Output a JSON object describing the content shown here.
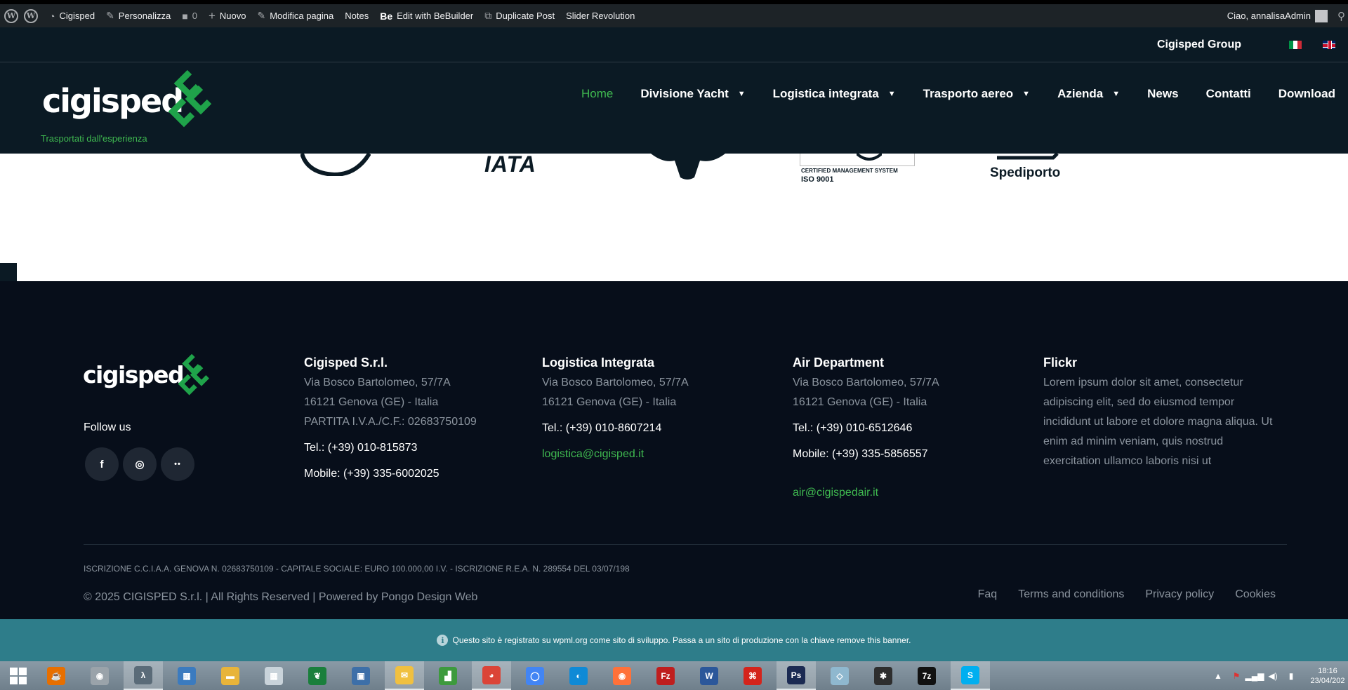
{
  "admin_bar": {
    "items": [
      {
        "label": "Cigisped",
        "icon": "dashboard-icon"
      },
      {
        "label": "Personalizza",
        "icon": "brush-icon"
      },
      {
        "label": "0",
        "icon": "comment-icon"
      },
      {
        "label": "Nuovo",
        "icon": "plus-icon"
      },
      {
        "label": "Modifica pagina",
        "icon": "pencil-icon"
      },
      {
        "label": "Notes",
        "icon": ""
      },
      {
        "label": "Edit with BeBuilder",
        "icon": "bebuilder-icon"
      },
      {
        "label": "Duplicate Post",
        "icon": "duplicate-icon"
      },
      {
        "label": "Slider Revolution",
        "icon": ""
      }
    ],
    "greeting": "Ciao, annalisaAdmin"
  },
  "header": {
    "group_link": "Cigisped Group",
    "logo_text": "cigisped",
    "tagline": "Trasportati dall'esperienza",
    "nav": [
      {
        "label": "Home",
        "active": true,
        "dropdown": false
      },
      {
        "label": "Divisione Yacht",
        "active": false,
        "dropdown": true
      },
      {
        "label": "Logistica integrata",
        "active": false,
        "dropdown": true
      },
      {
        "label": "Trasporto aereo",
        "active": false,
        "dropdown": true
      },
      {
        "label": "Azienda",
        "active": false,
        "dropdown": true
      },
      {
        "label": "News",
        "active": false,
        "dropdown": false
      },
      {
        "label": "Contatti",
        "active": false,
        "dropdown": false
      },
      {
        "label": "Download",
        "active": false,
        "dropdown": false
      }
    ],
    "caret": "▼"
  },
  "partner_logos": {
    "iata": "IATA",
    "iso_line1": "CERTIFIED MANAGEMENT SYSTEM",
    "iso_line2": "ISO 9001",
    "spediporto": "Spediporto"
  },
  "footer": {
    "logo_text": "cigisped",
    "follow_us": "Follow us",
    "socials": [
      {
        "name": "facebook",
        "glyph": "f"
      },
      {
        "name": "instagram",
        "glyph": "◎"
      },
      {
        "name": "flickr",
        "glyph": "••"
      }
    ],
    "columns": {
      "cigisped": {
        "title": "Cigisped S.r.l.",
        "address1": "Via Bosco Bartolomeo, 57/7A",
        "address2": "16121 Genova (GE) - Italia",
        "vat": "PARTITA I.V.A./C.F.: 02683750109",
        "tel": "Tel.: (+39) 010-815873",
        "mobile": "Mobile: (+39) 335-6002025"
      },
      "logistica": {
        "title": "Logistica Integrata",
        "address1": "Via Bosco Bartolomeo, 57/7A",
        "address2": "16121 Genova (GE) - Italia",
        "tel": "Tel.: (+39) 010-8607214",
        "email": "logistica@cigisped.it"
      },
      "air": {
        "title": "Air Department",
        "address1": "Via Bosco Bartolomeo, 57/7A",
        "address2": "16121 Genova (GE) - Italia",
        "tel": "Tel.: (+39) 010-6512646",
        "mobile": "Mobile: (+39) 335-5856557",
        "email": "air@cigispedair.it"
      },
      "flickr": {
        "title": "Flickr",
        "text": "Lorem ipsum dolor sit amet, consectetur adipiscing elit, sed do eiusmod tempor incididunt ut labore et dolore magna aliqua. Ut enim ad minim veniam, quis nostrud exercitation ullamco laboris nisi ut"
      }
    },
    "legal": "ISCRIZIONE C.C.I.A.A. GENOVA N. 02683750109 - CAPITALE SOCIALE: EURO 100.000,00 I.V. - ISCRIZIONE R.E.A. N. 289554 DEL 03/07/198",
    "copyright": "© 2025 CIGISPED S.r.l.  | All Rights Reserved | Powered by Pongo Design Web",
    "links": [
      "Faq",
      "Terms and conditions",
      "Privacy policy",
      "Cookies"
    ]
  },
  "wpml_banner": {
    "text": "Questo sito è registrato su wpml.org come sito di sviluppo. Passa a un sito di produzione con la chiave remove this banner."
  },
  "taskbar": {
    "apps": [
      {
        "name": "java",
        "color": "#e76f00",
        "glyph": "☕",
        "open": false
      },
      {
        "name": "speaker",
        "color": "#9aa3aa",
        "glyph": "◉",
        "open": false
      },
      {
        "name": "xampp",
        "color": "#5a6b78",
        "glyph": "λ",
        "open": true
      },
      {
        "name": "control-panel",
        "color": "#3b7bbf",
        "glyph": "▦",
        "open": false
      },
      {
        "name": "file-explorer",
        "color": "#e8b43a",
        "glyph": "▬",
        "open": false
      },
      {
        "name": "calculator",
        "color": "#c9d3da",
        "glyph": "▦",
        "open": false
      },
      {
        "name": "butterfly-app",
        "color": "#1a7f3c",
        "glyph": "❦",
        "open": false
      },
      {
        "name": "network",
        "color": "#3d6fa8",
        "glyph": "▣",
        "open": false
      },
      {
        "name": "outlook",
        "color": "#f0c040",
        "glyph": "✉",
        "open": true
      },
      {
        "name": "chart-app",
        "color": "#3d9a3d",
        "glyph": "▟",
        "open": false
      },
      {
        "name": "chrome",
        "color": "#db4437",
        "glyph": "◕",
        "open": true
      },
      {
        "name": "chromium",
        "color": "#4285f4",
        "glyph": "◯",
        "open": false
      },
      {
        "name": "edge",
        "color": "#0f8ad6",
        "glyph": "◐",
        "open": false
      },
      {
        "name": "firefox",
        "color": "#ff7139",
        "glyph": "◉",
        "open": false
      },
      {
        "name": "filezilla",
        "color": "#bf1e1e",
        "glyph": "Fz",
        "open": false
      },
      {
        "name": "word",
        "color": "#2b579a",
        "glyph": "W",
        "open": false
      },
      {
        "name": "acrobat",
        "color": "#d4241c",
        "glyph": "⌘",
        "open": false
      },
      {
        "name": "photoshop",
        "color": "#1b2a52",
        "glyph": "Ps",
        "open": true
      },
      {
        "name": "notepad",
        "color": "#8fb8cf",
        "glyph": "◇",
        "open": false
      },
      {
        "name": "inkscape",
        "color": "#2e2e2e",
        "glyph": "✱",
        "open": false
      },
      {
        "name": "7zip",
        "color": "#111111",
        "glyph": "7z",
        "open": false
      },
      {
        "name": "skype",
        "color": "#00aff0",
        "glyph": "S",
        "open": true
      }
    ],
    "time": "18:16",
    "date": "23/04/202"
  }
}
